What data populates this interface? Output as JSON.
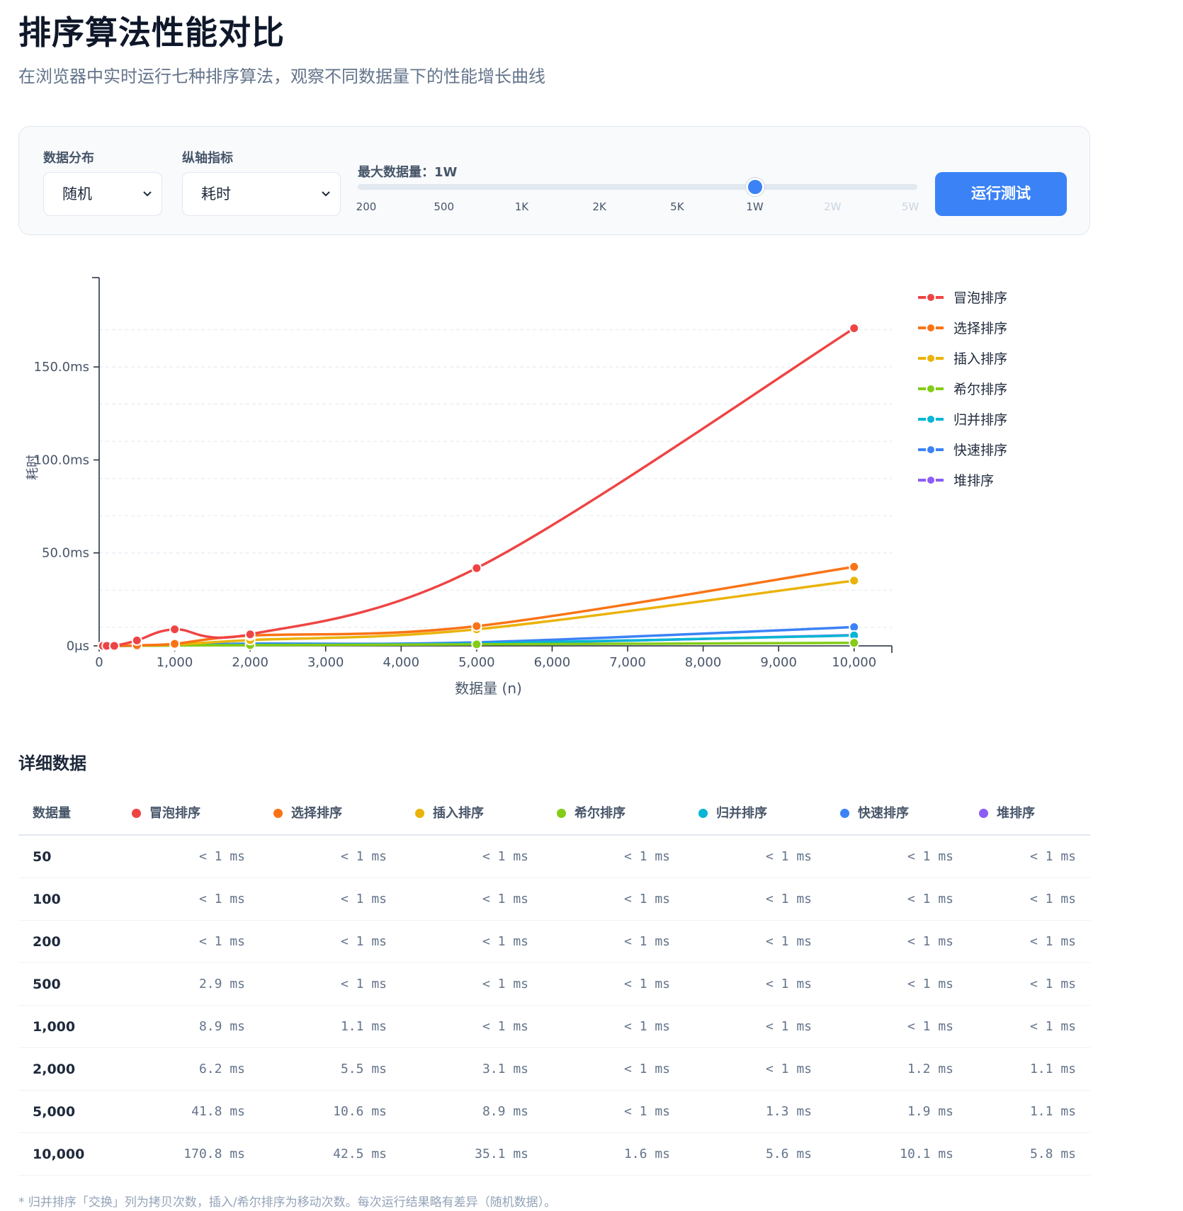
{
  "header": {
    "title": "排序算法性能对比",
    "subtitle": "在浏览器中实时运行七种排序算法，观察不同数据量下的性能增长曲线"
  },
  "controls": {
    "distribution_label": "数据分布",
    "distribution_value": "随机",
    "metric_label": "纵轴指标",
    "metric_value": "耗时",
    "max_size_label": "最大数据量：1W",
    "slider_ticks": [
      "200",
      "500",
      "1K",
      "2K",
      "5K",
      "1W",
      "2W",
      "5W"
    ],
    "slider_selected_index": 5,
    "run_button": "运行测试"
  },
  "colors": {
    "accent": "#3b82f6",
    "series": [
      "#ef4444",
      "#f97316",
      "#eab308",
      "#84cc16",
      "#06b6d4",
      "#3b82f6",
      "#8b5cf6"
    ]
  },
  "chart_data": {
    "type": "line",
    "xlabel": "数据量 (n)",
    "ylabel": "耗时",
    "x": [
      50,
      100,
      200,
      500,
      1000,
      2000,
      5000,
      10000
    ],
    "xlim": [
      0,
      10500
    ],
    "ylim": [
      0,
      195
    ],
    "x_ticks": [
      "0",
      "1,000",
      "2,000",
      "3,000",
      "4,000",
      "5,000",
      "6,000",
      "7,000",
      "8,000",
      "9,000",
      "10,000"
    ],
    "y_ticks": [
      "0μs",
      "50.0ms",
      "100.0ms",
      "150.0ms"
    ],
    "grid": true,
    "legend_position": "right",
    "series": [
      {
        "name": "冒泡排序",
        "values": [
          0,
          0,
          0,
          2.9,
          8.9,
          6.2,
          41.8,
          170.8
        ]
      },
      {
        "name": "选择排序",
        "values": [
          0,
          0,
          0,
          0.3,
          1.1,
          5.5,
          10.6,
          42.5
        ]
      },
      {
        "name": "插入排序",
        "values": [
          0,
          0,
          0,
          0.2,
          0.6,
          3.1,
          8.9,
          35.1
        ]
      },
      {
        "name": "希尔排序",
        "values": [
          0,
          0,
          0,
          0.1,
          0.2,
          0.4,
          0.8,
          1.6
        ]
      },
      {
        "name": "归并排序",
        "values": [
          0,
          0,
          0,
          0.1,
          0.3,
          0.6,
          1.3,
          5.6
        ]
      },
      {
        "name": "快速排序",
        "values": [
          0,
          0,
          0,
          0.1,
          0.3,
          1.2,
          1.9,
          10.1
        ]
      },
      {
        "name": "堆排序",
        "values": [
          0,
          0,
          0,
          0.1,
          0.3,
          1.1,
          1.1,
          5.8
        ]
      }
    ]
  },
  "table": {
    "section_title": "详细数据",
    "n_header": "数据量",
    "headers": [
      "冒泡排序",
      "选择排序",
      "插入排序",
      "希尔排序",
      "归并排序",
      "快速排序",
      "堆排序"
    ],
    "rows": [
      {
        "n": "50",
        "cells": [
          "< 1 ms",
          "< 1 ms",
          "< 1 ms",
          "< 1 ms",
          "< 1 ms",
          "< 1 ms",
          "< 1 ms"
        ]
      },
      {
        "n": "100",
        "cells": [
          "< 1 ms",
          "< 1 ms",
          "< 1 ms",
          "< 1 ms",
          "< 1 ms",
          "< 1 ms",
          "< 1 ms"
        ]
      },
      {
        "n": "200",
        "cells": [
          "< 1 ms",
          "< 1 ms",
          "< 1 ms",
          "< 1 ms",
          "< 1 ms",
          "< 1 ms",
          "< 1 ms"
        ]
      },
      {
        "n": "500",
        "cells": [
          "2.9 ms",
          "< 1 ms",
          "< 1 ms",
          "< 1 ms",
          "< 1 ms",
          "< 1 ms",
          "< 1 ms"
        ]
      },
      {
        "n": "1,000",
        "cells": [
          "8.9 ms",
          "1.1 ms",
          "< 1 ms",
          "< 1 ms",
          "< 1 ms",
          "< 1 ms",
          "< 1 ms"
        ]
      },
      {
        "n": "2,000",
        "cells": [
          "6.2 ms",
          "5.5 ms",
          "3.1 ms",
          "< 1 ms",
          "< 1 ms",
          "1.2 ms",
          "1.1 ms"
        ]
      },
      {
        "n": "5,000",
        "cells": [
          "41.8 ms",
          "10.6 ms",
          "8.9 ms",
          "< 1 ms",
          "1.3 ms",
          "1.9 ms",
          "1.1 ms"
        ]
      },
      {
        "n": "10,000",
        "cells": [
          "170.8 ms",
          "42.5 ms",
          "35.1 ms",
          "1.6 ms",
          "5.6 ms",
          "10.1 ms",
          "5.8 ms"
        ]
      }
    ]
  },
  "footnote": "* 归并排序「交换」列为拷贝次数，插入/希尔排序为移动次数。每次运行结果略有差异（随机数据）。"
}
